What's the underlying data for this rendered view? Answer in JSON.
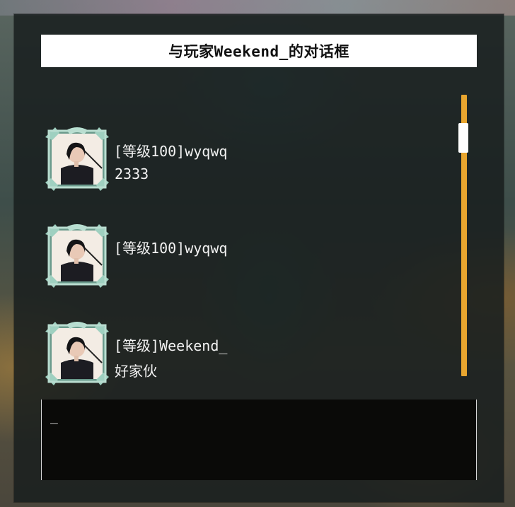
{
  "dialog": {
    "title": "与玩家Weekend_的对话框"
  },
  "messages": [
    {
      "sender": "[等级100]wyqwq",
      "text": "2333",
      "avatar_icon": "player-avatar-icon"
    },
    {
      "sender": "[等级100]wyqwq",
      "text": "",
      "avatar_icon": "player-avatar-icon"
    },
    {
      "sender": "[等级]Weekend_",
      "text": "好家伙",
      "avatar_icon": "player-avatar-icon"
    }
  ],
  "input": {
    "value": "_"
  },
  "colors": {
    "panel_bg": "#181e1e",
    "title_bg": "#ffffff",
    "scrollbar_track": "#e9a62f",
    "scrollbar_thumb": "#ffffff",
    "input_bg": "#0a0a08",
    "avatar_frame": "#8fbfae"
  },
  "scroll": {
    "position_fraction": 0.1
  }
}
